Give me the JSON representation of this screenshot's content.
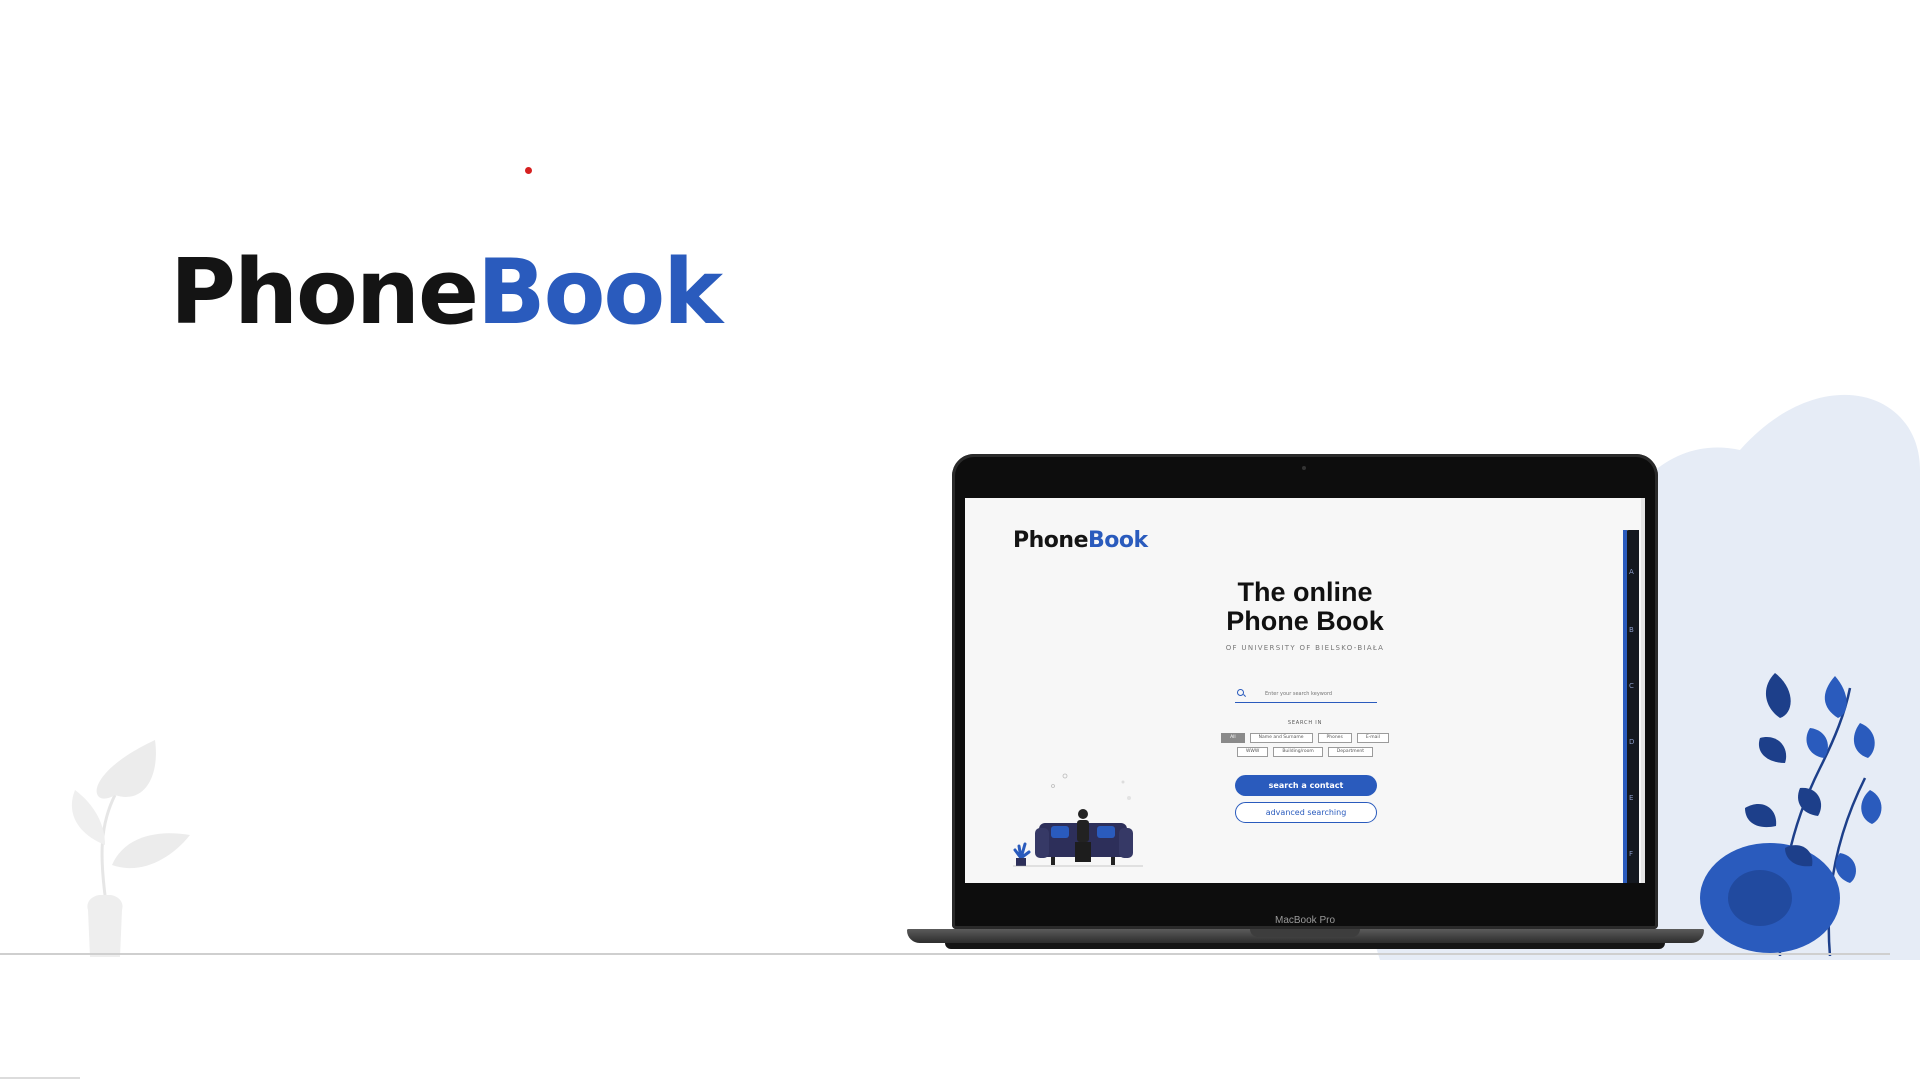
{
  "logo": {
    "part1": "Phone",
    "part2": "Book"
  },
  "laptop": {
    "brand": "MacBook Pro"
  },
  "screen": {
    "logo": {
      "part1": "Phone",
      "part2": "Book"
    },
    "title_line1": "The online",
    "title_line2": "Phone Book",
    "subtitle": "OF UNIVERSITY OF BIELSKO-BIAŁA",
    "search": {
      "placeholder": "Enter your search keyword"
    },
    "search_in_label": "SEARCH IN",
    "filters_row1": [
      "All",
      "Name and Surname",
      "Phones",
      "E-mail"
    ],
    "filters_row2": [
      "WWW",
      "Building/room",
      "Department"
    ],
    "active_filter": "All",
    "primary_button": "search a contact",
    "secondary_button": "advanced searching",
    "alphabet": [
      "A",
      "B",
      "C",
      "D",
      "E",
      "F"
    ]
  },
  "colors": {
    "brand_blue": "#2a5bbd",
    "logo_dark": "#141414",
    "cloud": "#e6ecf6",
    "leaf_blue": "#2a5bbd",
    "leaf_dark": "#1d3f8a",
    "ghost_plant": "#eeeeee"
  }
}
